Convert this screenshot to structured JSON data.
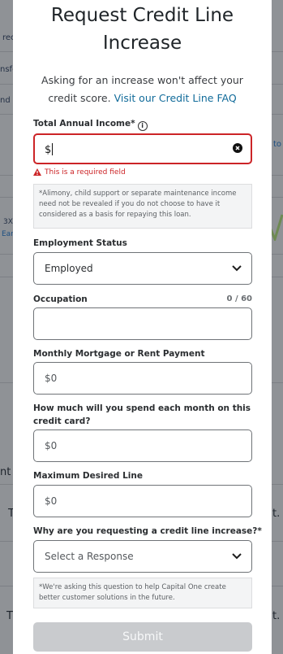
{
  "background": {
    "frag1": "rec",
    "frag2": "nsfe",
    "frag3": "nd",
    "frag4": "to",
    "frag5": "3X",
    "frag6": "Ear",
    "frag7": "nt",
    "frag8": "T",
    "frag9": "t.",
    "frag10": "T",
    "frag11": "t."
  },
  "modal": {
    "title_line1": "Request Credit Line",
    "title_line2": "Increase",
    "subtitle_line1": "Asking for an increase won't affect your",
    "subtitle_line2_prefix": "credit score.",
    "faq_link": "Visit our Credit Line FAQ"
  },
  "income": {
    "label": "Total Annual Income*",
    "value": "$",
    "error": "This is a required field",
    "note": "*Alimony, child support or separate maintenance income need not be revealed if you do not choose to have it considered as a basis for repaying this loan."
  },
  "employment": {
    "label": "Employment Status",
    "selected": "Employed"
  },
  "occupation": {
    "label": "Occupation",
    "counter": "0 / 60",
    "value": ""
  },
  "mortgage": {
    "label": "Monthly Mortgage or Rent Payment",
    "placeholder": "$0"
  },
  "spend": {
    "label": "How much will you spend each month on this credit card?",
    "placeholder": "$0"
  },
  "max_line": {
    "label": "Maximum Desired Line",
    "placeholder": "$0"
  },
  "reason": {
    "label": "Why are you requesting a credit line increase?*",
    "selected": "Select a Response",
    "note": "*We're asking this question to help Capital One create better customer solutions in the future."
  },
  "submit_label": "Submit",
  "colors": {
    "error": "#cc2427",
    "link": "#116b9a",
    "submit_disabled": "#c9cbce"
  }
}
